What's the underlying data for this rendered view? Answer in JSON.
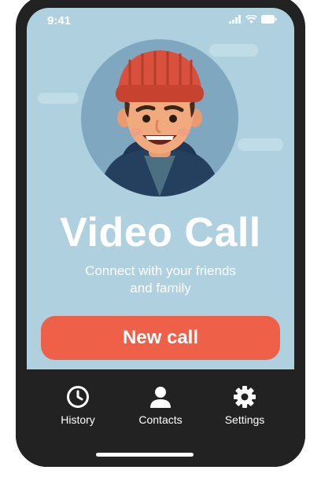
{
  "status_bar": {
    "time": "9:41"
  },
  "hero": {
    "title": "Video Call",
    "subtitle_line1": "Connect with your friends",
    "subtitle_line2": "and family"
  },
  "primary_action": {
    "label": "New call"
  },
  "tab_bar": {
    "items": [
      {
        "label": "History",
        "icon": "clock-icon"
      },
      {
        "label": "Contacts",
        "icon": "person-icon"
      },
      {
        "label": "Settings",
        "icon": "gear-icon"
      }
    ]
  },
  "colors": {
    "screen_background": "#afd0de",
    "accent": "#ee6048",
    "device_frame": "#222222"
  }
}
